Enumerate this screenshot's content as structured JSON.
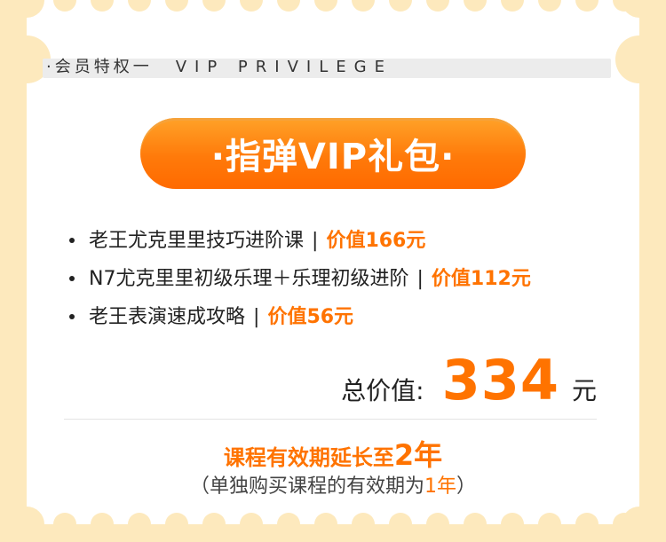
{
  "header": {
    "cn": "·会员特权一",
    "en": "VIP PRIVILEGE"
  },
  "pill": {
    "title": "·指弹VIP礼包·"
  },
  "items": [
    {
      "text": "老王尤克里里技巧进阶课",
      "sep": "|",
      "price": "价值166元"
    },
    {
      "text": "N7尤克里里初级乐理＋乐理初级进阶",
      "sep": "|",
      "price": "价值112元"
    },
    {
      "text": "老王表演速成攻略",
      "sep": "|",
      "price": "价值56元"
    }
  ],
  "total": {
    "label": "总价值:",
    "value": "334",
    "unit": "元"
  },
  "validity": {
    "prefix": "课程有效期延长至",
    "highlight": "2年"
  },
  "note": {
    "prefix": "（单独购买课程的有效期为",
    "highlight": "1年",
    "suffix": "）"
  },
  "colors": {
    "accent": "#ff7300",
    "background": "#fde9bd",
    "card": "#ffffff"
  }
}
